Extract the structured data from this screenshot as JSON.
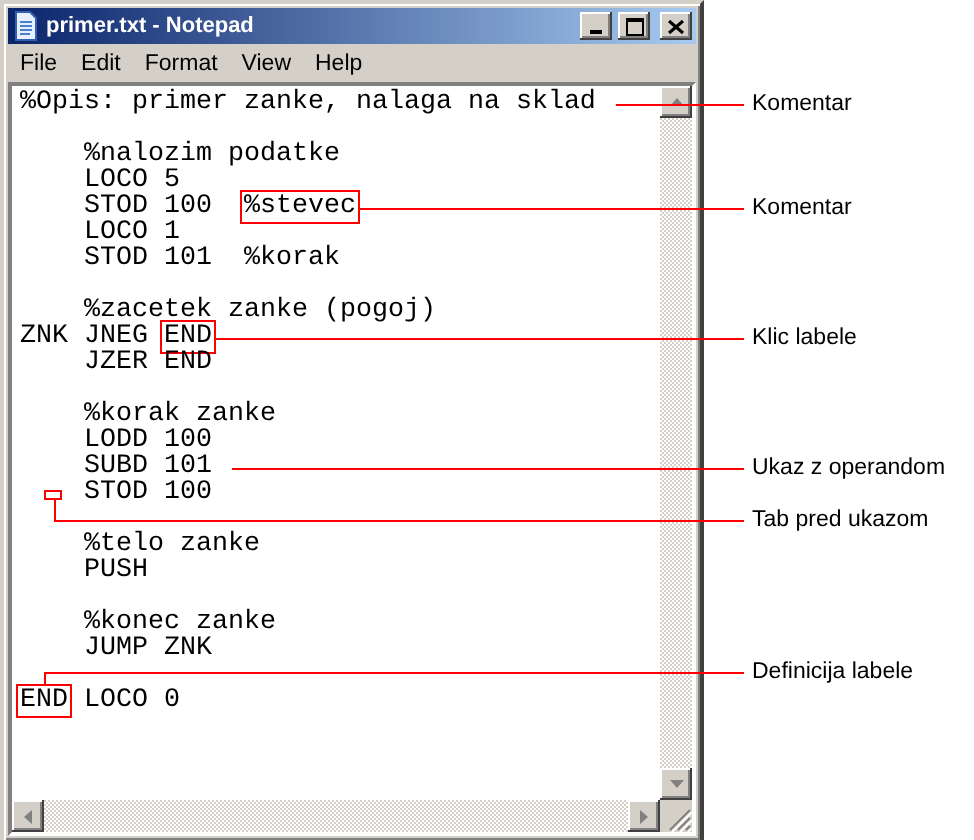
{
  "window": {
    "title": "primer.txt - Notepad"
  },
  "menu": [
    "File",
    "Edit",
    "Format",
    "View",
    "Help"
  ],
  "lines": [
    {
      "kind": "code",
      "segments": [
        {
          "text": "%Opis: primer zanke, nalaga na sklad",
          "boxed": false
        }
      ],
      "callout": "Komentar"
    },
    {
      "kind": "blank"
    },
    {
      "kind": "code",
      "segments": [
        {
          "text": "\t%nalozim podatke",
          "boxed": false
        }
      ]
    },
    {
      "kind": "code",
      "segments": [
        {
          "text": "\tLOCO 5",
          "boxed": false
        }
      ]
    },
    {
      "kind": "code",
      "segments": [
        {
          "text": "\tSTOD 100  ",
          "boxed": false
        },
        {
          "text": "%stevec",
          "boxed": true
        }
      ],
      "callout": "Komentar"
    },
    {
      "kind": "code",
      "segments": [
        {
          "text": "\tLOCO 1",
          "boxed": false
        }
      ]
    },
    {
      "kind": "code",
      "segments": [
        {
          "text": "\tSTOD 101  %korak",
          "boxed": false
        }
      ]
    },
    {
      "kind": "blank"
    },
    {
      "kind": "code",
      "segments": [
        {
          "text": "\t%zacetek zanke (pogoj)",
          "boxed": false
        }
      ]
    },
    {
      "kind": "code",
      "segments": [
        {
          "text": "ZNK\tJNEG ",
          "boxed": false
        },
        {
          "text": "END",
          "boxed": true
        }
      ],
      "callout": "Klic labele"
    },
    {
      "kind": "code",
      "segments": [
        {
          "text": "\tJZER END",
          "boxed": false
        }
      ]
    },
    {
      "kind": "blank"
    },
    {
      "kind": "code",
      "segments": [
        {
          "text": "\t%korak zanke",
          "boxed": false
        }
      ]
    },
    {
      "kind": "code",
      "segments": [
        {
          "text": "\tLODD 100",
          "boxed": false
        }
      ]
    },
    {
      "kind": "code",
      "segments": [
        {
          "text": "\tSUBD 101",
          "boxed": false
        }
      ],
      "callout": "Ukaz z operandom"
    },
    {
      "kind": "code",
      "tab_marked": true,
      "segments": [
        {
          "text": "\tSTOD 100",
          "boxed": false
        }
      ],
      "callout": "Tab pred ukazom"
    },
    {
      "kind": "blank"
    },
    {
      "kind": "code",
      "segments": [
        {
          "text": "\t%telo zanke",
          "boxed": false
        }
      ]
    },
    {
      "kind": "code",
      "segments": [
        {
          "text": "\tPUSH",
          "boxed": false
        }
      ]
    },
    {
      "kind": "blank"
    },
    {
      "kind": "code",
      "segments": [
        {
          "text": "\t%konec zanke",
          "boxed": false
        }
      ]
    },
    {
      "kind": "code",
      "segments": [
        {
          "text": "\tJUMP ZNK",
          "boxed": false
        }
      ]
    },
    {
      "kind": "blank"
    },
    {
      "kind": "code",
      "segments": [
        {
          "text": "END",
          "boxed": true
        },
        {
          "text": "\tLOCO 0",
          "boxed": false
        }
      ],
      "callout": "Definicija labele"
    }
  ]
}
